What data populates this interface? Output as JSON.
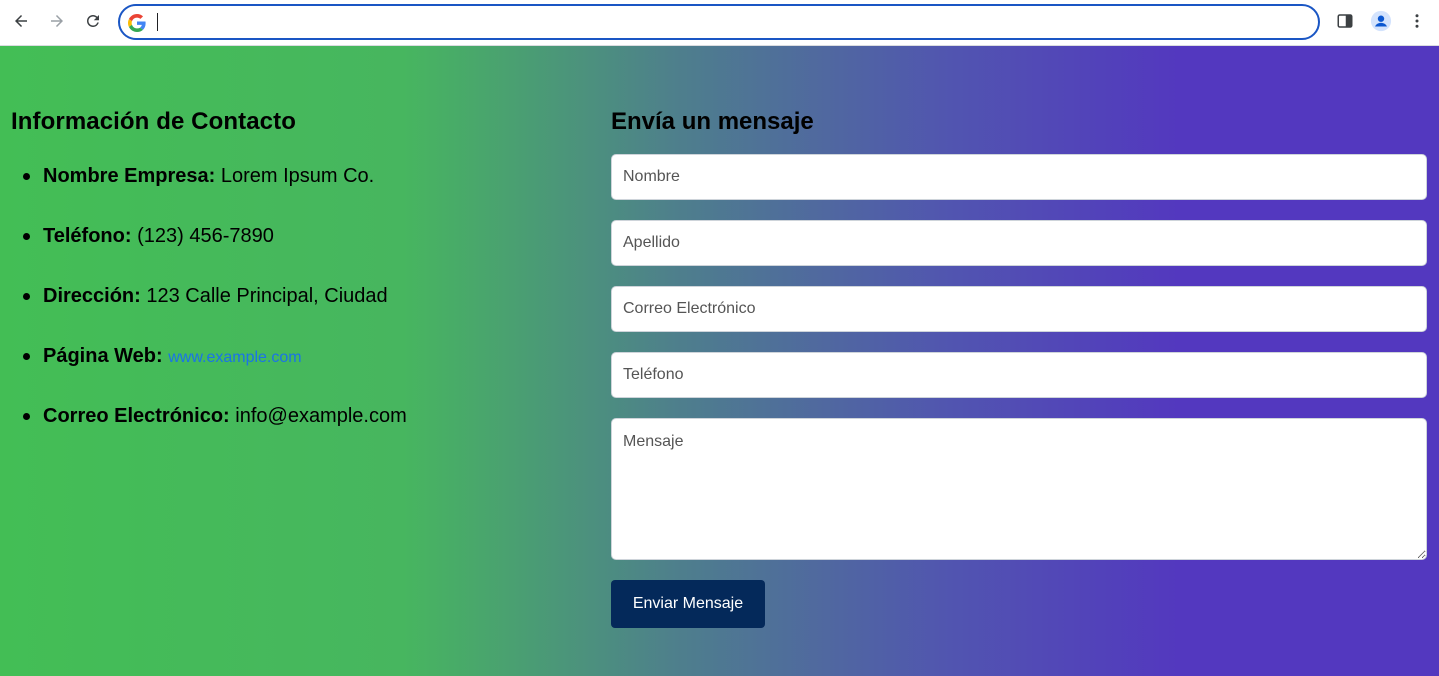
{
  "browser": {
    "address_value": "",
    "icons": [
      "back-arrow-icon",
      "forward-arrow-icon",
      "reload-icon",
      "google-icon",
      "side-panel-icon",
      "profile-icon",
      "more-vert-icon"
    ]
  },
  "contact": {
    "heading": "Información de Contacto",
    "items": [
      {
        "label": "Nombre Empresa:",
        "value": "Lorem Ipsum Co."
      },
      {
        "label": "Teléfono:",
        "value": "(123) 456-7890"
      },
      {
        "label": "Dirección:",
        "value": "123 Calle Principal, Ciudad"
      },
      {
        "label": "Página Web:",
        "value": "www.example.com"
      },
      {
        "label": "Correo Electrónico:",
        "value": "info@example.com"
      }
    ],
    "link_color": "#1a73e8"
  },
  "form": {
    "heading": "Envía un mensaje",
    "fields": {
      "nombre_placeholder": "Nombre",
      "apellido_placeholder": "Apellido",
      "email_placeholder": "Correo Electrónico",
      "telefono_placeholder": "Teléfono",
      "mensaje_placeholder": "Mensaje"
    },
    "submit_label": "Enviar Mensaje",
    "submit_color": "#04295a"
  },
  "theme": {
    "gradient_start": "#43be55",
    "gradient_end": "#5338bf"
  }
}
